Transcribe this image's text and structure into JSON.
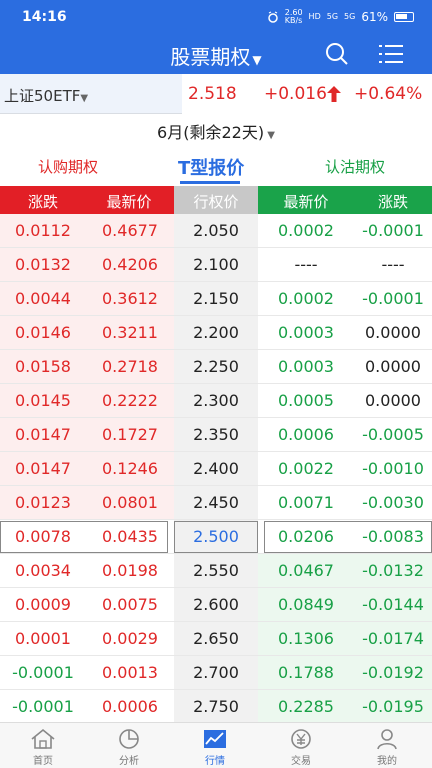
{
  "status_bar": {
    "time": "14:16",
    "speed": "2.60\nKB/s",
    "network1": "HD",
    "network2": "5G",
    "network3": "5G",
    "battery": "61%"
  },
  "header": {
    "title": "股票期权",
    "search_icon": "search-icon",
    "menu_icon": "menu-icon"
  },
  "quote": {
    "underlying": "上证50ETF",
    "price": "2.518",
    "change": "+0.016",
    "change_pct": "+0.64%",
    "up_color": "#e02828"
  },
  "expiry": {
    "label": "6月(剩余22天)"
  },
  "tabs": {
    "call": "认购期权",
    "t_quote": "T型报价",
    "put": "认沽期权"
  },
  "columns": {
    "call_change": "涨跌",
    "call_last": "最新价",
    "strike": "行权价",
    "put_last": "最新价",
    "put_change": "涨跌"
  },
  "colors": {
    "red": "#e02828",
    "green": "#18a046",
    "blue": "#2b6de0",
    "call_bg": "#fdeeee",
    "put_bg": "#ecf8ef"
  },
  "rows": [
    {
      "call_change": "0.0112",
      "call_last": "0.4677",
      "strike": "2.050",
      "put_last": "0.0002",
      "put_change": "-0.0001"
    },
    {
      "call_change": "0.0132",
      "call_last": "0.4206",
      "strike": "2.100",
      "put_last": "----",
      "put_change": "----"
    },
    {
      "call_change": "0.0044",
      "call_last": "0.3612",
      "strike": "2.150",
      "put_last": "0.0002",
      "put_change": "-0.0001"
    },
    {
      "call_change": "0.0146",
      "call_last": "0.3211",
      "strike": "2.200",
      "put_last": "0.0003",
      "put_change": "0.0000"
    },
    {
      "call_change": "0.0158",
      "call_last": "0.2718",
      "strike": "2.250",
      "put_last": "0.0003",
      "put_change": "0.0000"
    },
    {
      "call_change": "0.0145",
      "call_last": "0.2222",
      "strike": "2.300",
      "put_last": "0.0005",
      "put_change": "0.0000"
    },
    {
      "call_change": "0.0147",
      "call_last": "0.1727",
      "strike": "2.350",
      "put_last": "0.0006",
      "put_change": "-0.0005"
    },
    {
      "call_change": "0.0147",
      "call_last": "0.1246",
      "strike": "2.400",
      "put_last": "0.0022",
      "put_change": "-0.0010"
    },
    {
      "call_change": "0.0123",
      "call_last": "0.0801",
      "strike": "2.450",
      "put_last": "0.0071",
      "put_change": "-0.0030"
    },
    {
      "call_change": "0.0078",
      "call_last": "0.0435",
      "strike": "2.500",
      "put_last": "0.0206",
      "put_change": "-0.0083",
      "atm": true
    },
    {
      "call_change": "0.0034",
      "call_last": "0.0198",
      "strike": "2.550",
      "put_last": "0.0467",
      "put_change": "-0.0132"
    },
    {
      "call_change": "0.0009",
      "call_last": "0.0075",
      "strike": "2.600",
      "put_last": "0.0849",
      "put_change": "-0.0144"
    },
    {
      "call_change": "0.0001",
      "call_last": "0.0029",
      "strike": "2.650",
      "put_last": "0.1306",
      "put_change": "-0.0174"
    },
    {
      "call_change": "-0.0001",
      "call_last": "0.0013",
      "strike": "2.700",
      "put_last": "0.1788",
      "put_change": "-0.0192"
    },
    {
      "call_change": "-0.0001",
      "call_last": "0.0006",
      "strike": "2.750",
      "put_last": "0.2285",
      "put_change": "-0.0195"
    }
  ],
  "nav": [
    {
      "label": "首页",
      "icon": "home-icon"
    },
    {
      "label": "分析",
      "icon": "pie-chart-icon"
    },
    {
      "label": "行情",
      "icon": "trend-chart-icon",
      "active": true
    },
    {
      "label": "交易",
      "icon": "yen-icon"
    },
    {
      "label": "我的",
      "icon": "user-icon"
    }
  ]
}
